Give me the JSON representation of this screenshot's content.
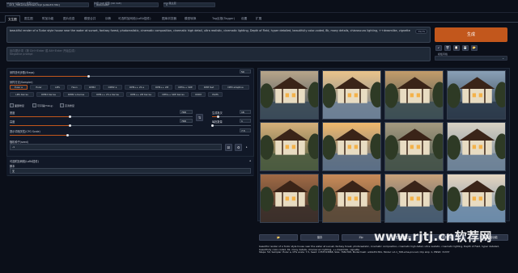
{
  "header": {
    "model_label": "Stable Diffusion 模型(ckpt)",
    "model_value": "v2-1_768-ema-pruned.ckpt [ad2a33c361]",
    "vae_label": "外挂 VAE 模型 (SD VAE)",
    "vae_value": "Automatic",
    "clip_label": "Clip 跳过层",
    "clip_value": "1"
  },
  "tabs": [
    "文生图",
    "图生图",
    "附加功能",
    "图片信息",
    "模型合并",
    "训练",
    "可选附加网络(LoRA插件)",
    "图库浏览器",
    "模型转换",
    "Tag反推(Tagger)",
    "设置",
    "扩展"
  ],
  "prompt": {
    "positive": "beautiful render of a Tudor style house near the water at sunset, fantasy forest, photorealistic, cinematic composition, cinematic high detail, ultra realistic, cinematic lighting, Depth of Field, hyper detailed, beautifully color-coded, 8k, many details, chiaroscuro lighting, ++dreamlike, vignette",
    "token_count": "75/75",
    "negative_placeholder": "反向提示词（按 Ctrl+Enter 或 Alt+Enter 开始生成）",
    "negative_sub": "Negative prompt"
  },
  "generate_label": "生成",
  "tools": [
    "↙",
    "🗑",
    "📋",
    "💾",
    "📂"
  ],
  "styles_label": "模板风格",
  "sampling": {
    "steps_label": "采样迭代步数(Steps)",
    "steps_value": "50",
    "steps_fraction": 0.33,
    "method_label": "采样方法(Sampler)",
    "methods": [
      "Euler a",
      "Euler",
      "LMS",
      "Heun",
      "DPM2",
      "DPM2 a",
      "DPM++ 2S a",
      "DPM++ 2M",
      "DPM++ SDE",
      "DPM fast",
      "DPM adaptive",
      "LMS Karras",
      "DPM2 Karras",
      "DPM2 a Karras",
      "DPM++ 2S a Karras",
      "DPM++ 2M Karras",
      "DPM++ SDE Karras",
      "DDIM",
      "PLMS"
    ],
    "selected_method": "Euler a"
  },
  "options": {
    "restore_faces": "面部修复",
    "tiling": "可平铺(Tiling)",
    "hires_fix": "高清修复"
  },
  "size": {
    "width_label": "宽度",
    "width_value": "768",
    "width_fraction": 0.33,
    "height_label": "高度",
    "height_value": "768",
    "height_fraction": 0.33,
    "swap_icon": "⇅",
    "batch_count_label": "生成批次",
    "batch_count_value": "16",
    "batch_count_fraction": 0.15,
    "batch_size_label": "每批数量",
    "batch_size_value": "1",
    "batch_size_fraction": 0.0
  },
  "cfg": {
    "label": "提示词相关性(CFG Scale)",
    "value": "7.5",
    "fraction": 0.24
  },
  "seed": {
    "label": "随机种子(seed)",
    "value": "-1"
  },
  "lora": {
    "title": "可选附加网络(LoRA插件)",
    "script_label": "脚本",
    "script_value": "无"
  },
  "gallery": {
    "count": 12
  },
  "actions": {
    "open_folder": "📂",
    "save": "保存",
    "zip": "Zip",
    "send_img2img": "发送到图生图",
    "send_inpaint": "发送到重绘",
    "send_extras": "发送到附加功能"
  },
  "info_text": "beautiful render of a Tudor style house near the water at sunset, fantasy forest, photorealistic, cinematic composition, cinematic high detail, ultra realistic, cinematic lighting, Depth of Field, hyper detailed, beautifully color-coded, 8k, many details, chiaroscuro lighting, ++dreamlike, vignette\nSteps: 50, Sampler: Euler a, CFG scale: 7.5, Seed: 1355743868, Size: 768x768, Model hash: ad2a33c361, Model: v2-1_768-ema-pruned, Clip skip: 1, ENSD: 31337",
  "watermark": "www.rjtj.cn软荐网"
}
